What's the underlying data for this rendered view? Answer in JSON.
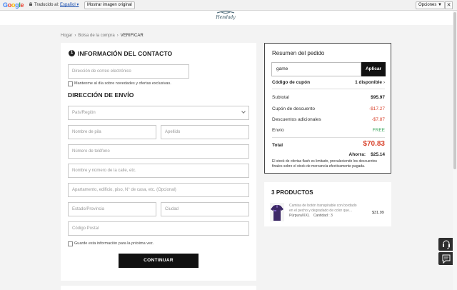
{
  "translate_bar": {
    "google_logo": "Google",
    "translated_to_label": "Traducido al:",
    "language": "Español",
    "show_original_button": "Mostrar imagen original",
    "options_button": "Opciones ▼",
    "close_button": "✕"
  },
  "header": {
    "logo_text": "Hendady"
  },
  "breadcrumb": [
    "Hogar",
    "Bolsa de la compra",
    "VERIFICAR"
  ],
  "contact": {
    "step_number": "1",
    "title": "INFORMACIÓN DEL CONTACTO",
    "email_placeholder": "Dirección de correo electrónico",
    "newsletter_label": "Mantenme al día sobre novedades y ofertas exclusivas."
  },
  "shipping": {
    "title": "DIRECCIÓN DE ENVÍO",
    "country_placeholder": "País/Región",
    "first_name_placeholder": "Nombre de pila",
    "last_name_placeholder": "Apellido",
    "phone_placeholder": "Número de teléfono",
    "street_placeholder": "Nombre y número de la calle, etc.",
    "apartment_placeholder": "Apartamento, edificio, piso, N° de casa, etc. (Opcional)",
    "state_placeholder": "Estado/Provincia",
    "city_placeholder": "Ciudad",
    "postal_placeholder": "Código Postal",
    "save_info_label": "Guarde esta información para la próxima vez.",
    "continue_button": "CONTINUAR"
  },
  "summary": {
    "title": "Resumen del pedido",
    "coupon_value": "game",
    "apply_button": "Aplicar",
    "coupon_code_label": "Código de cupón",
    "coupon_available": "1 disponible",
    "subtotal_label": "Subtotal",
    "subtotal_value": "$95.97",
    "discount_label": "Cupón de descuento",
    "discount_value": "-$17.27",
    "extra_discount_label": "Descuentos adicionales",
    "extra_discount_value": "-$7.87",
    "shipping_label": "Envío",
    "shipping_value": "FREE",
    "total_label": "Total",
    "total_value": "$70.83",
    "savings_label": "Ahorra:",
    "savings_value": "$25.14",
    "stock_note": "El stock de ofertas flash es limitado, prevaleciendo los descuentos finales sobre el stock de mercancía efectivamente pagada."
  },
  "products": {
    "title": "3 PRODUCTOS",
    "item": {
      "description": "Camisa de botón transpirable con bordado en el pecho y degradado de color que...",
      "variant": "Púrpura/XXL",
      "quantity_label": "Cantidad : 3",
      "price": "$31.99"
    }
  },
  "colors": {
    "accent_red": "#d9452f",
    "free_green": "#3aa55c",
    "dark": "#111111"
  },
  "icons": [
    "lock-icon",
    "chevron-right-icon",
    "chevron-down-icon",
    "headset-icon",
    "chat-icon"
  ]
}
